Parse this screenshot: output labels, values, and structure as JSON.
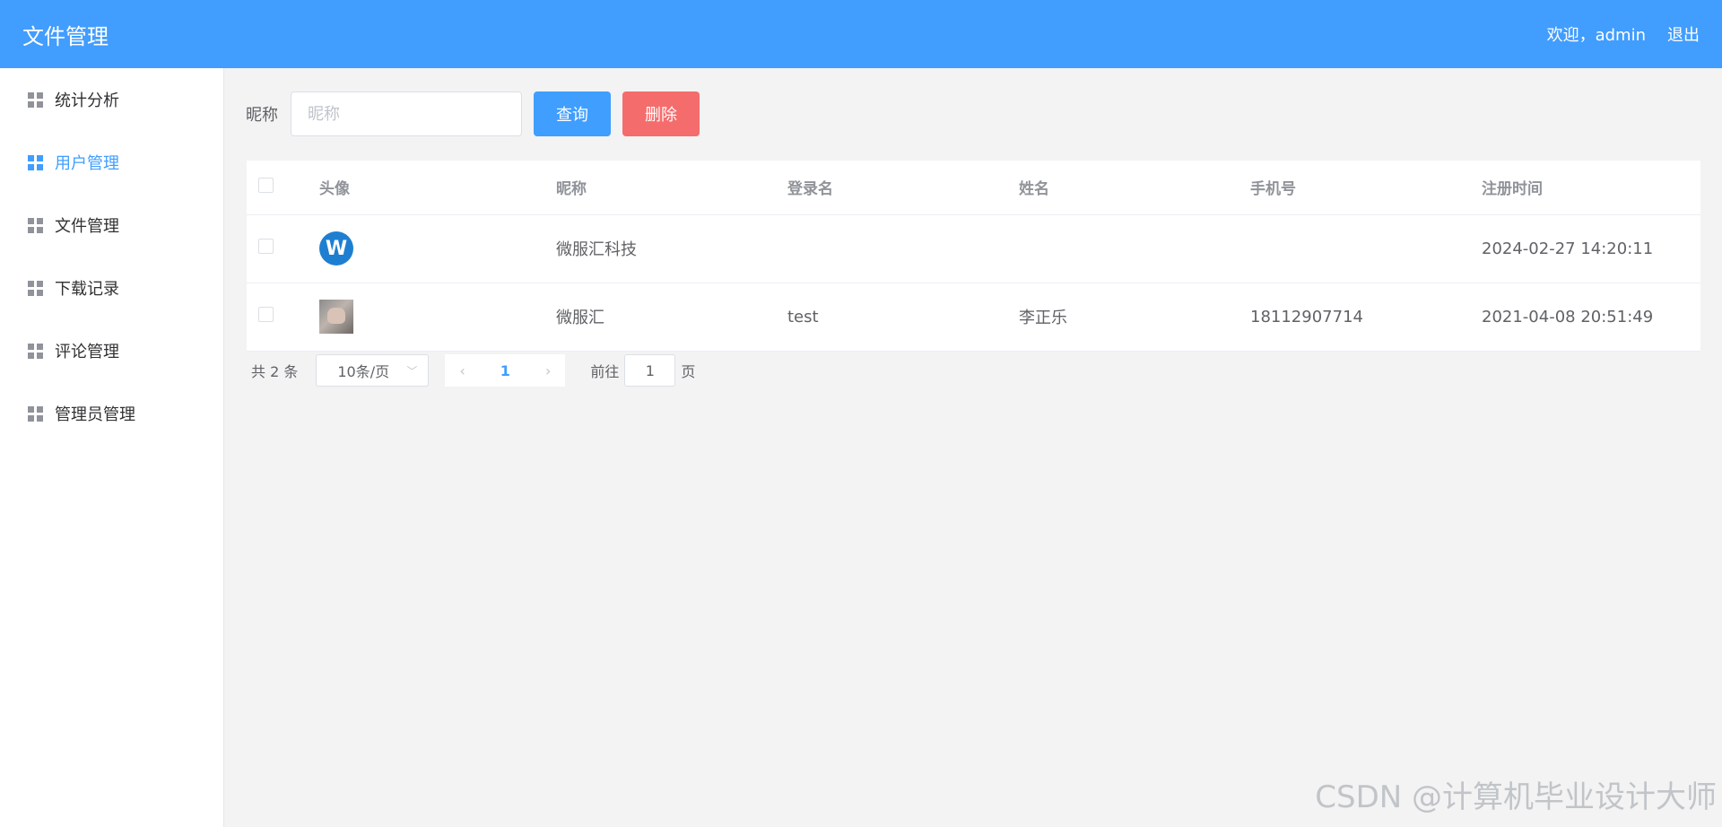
{
  "header": {
    "title": "文件管理",
    "welcome": "欢迎，admin",
    "logout": "退出"
  },
  "sidebar": {
    "items": [
      {
        "label": "统计分析",
        "icon": "grid-icon",
        "active": false
      },
      {
        "label": "用户管理",
        "icon": "grid-icon",
        "active": true
      },
      {
        "label": "文件管理",
        "icon": "grid-icon",
        "active": false
      },
      {
        "label": "下载记录",
        "icon": "grid-icon",
        "active": false
      },
      {
        "label": "评论管理",
        "icon": "grid-icon",
        "active": false
      },
      {
        "label": "管理员管理",
        "icon": "grid-icon",
        "active": false
      }
    ]
  },
  "search": {
    "label": "昵称",
    "placeholder": "昵称",
    "query_button": "查询",
    "delete_button": "删除"
  },
  "table": {
    "headers": [
      "头像",
      "昵称",
      "登录名",
      "姓名",
      "手机号",
      "注册时间"
    ],
    "rows": [
      {
        "avatar": "w-logo",
        "avatar_letter": "W",
        "nickname": "微服汇科技",
        "login": "",
        "name": "",
        "phone": "",
        "registered": "2024-02-27 14:20:11"
      },
      {
        "avatar": "photo",
        "nickname": "微服汇",
        "login": "test",
        "name": "李正乐",
        "phone": "18112907714",
        "registered": "2021-04-08 20:51:49"
      }
    ]
  },
  "pagination": {
    "total": "共 2 条",
    "page_size": "10条/页",
    "current_page": "1",
    "goto_label": "前往",
    "goto_value": "1",
    "page_suffix": "页"
  },
  "watermark": "CSDN @计算机毕业设计大师",
  "colors": {
    "header_bg": "#419dfe",
    "primary": "#409eff",
    "danger": "#f56c6c"
  }
}
